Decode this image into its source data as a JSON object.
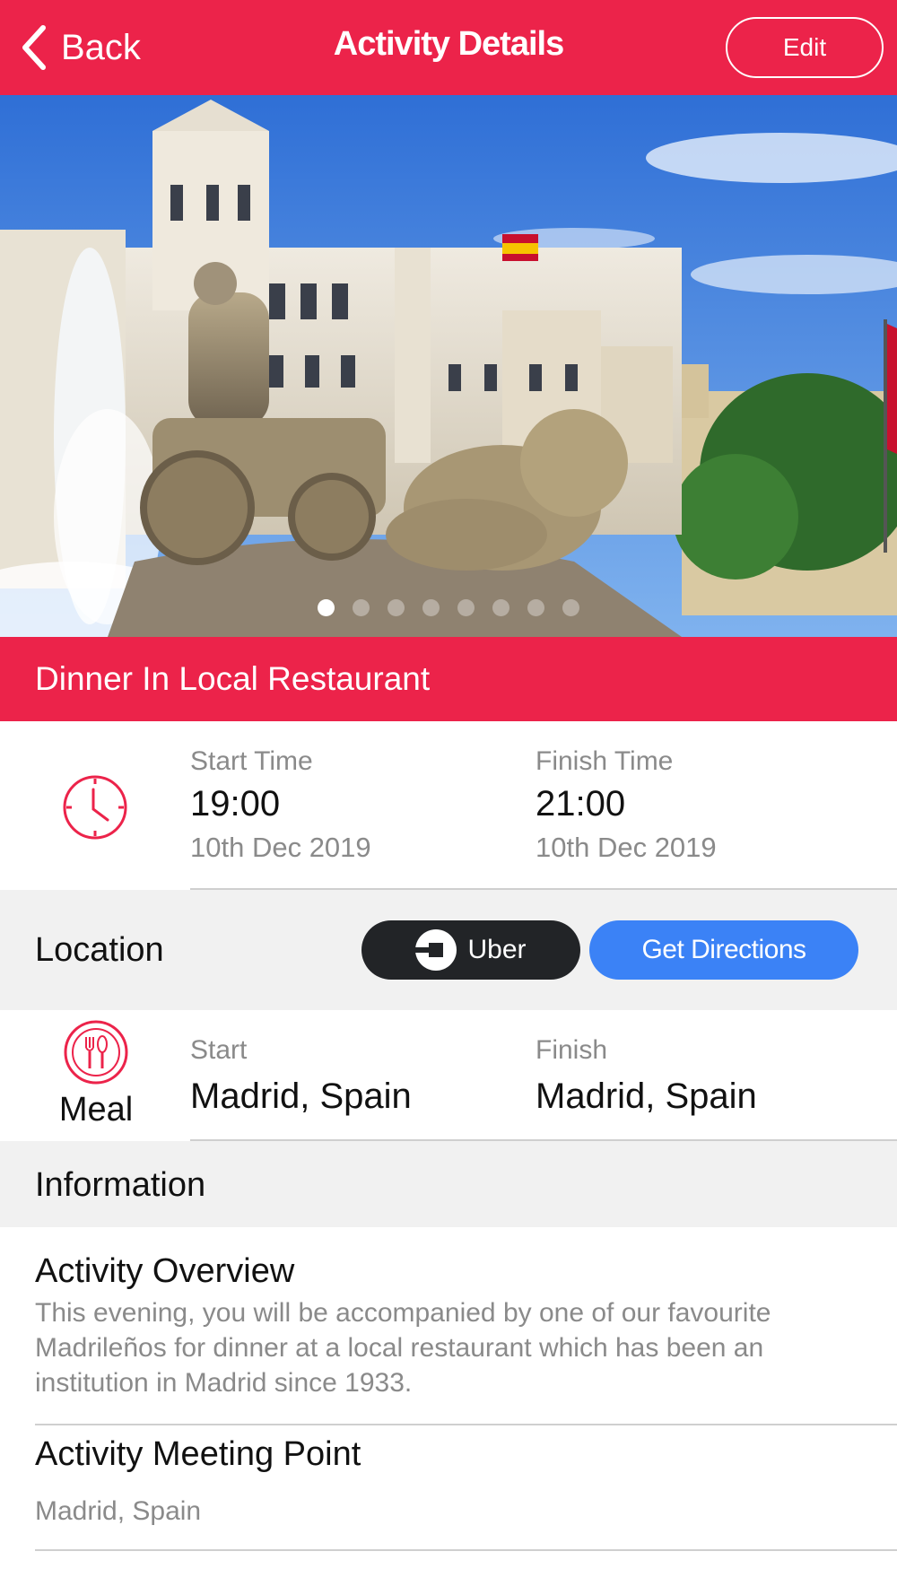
{
  "header": {
    "back_label": "Back",
    "title": "Activity Details",
    "edit_label": "Edit"
  },
  "gallery": {
    "total_images": 8,
    "active_index": 0
  },
  "activity": {
    "title": "Dinner In Local Restaurant"
  },
  "time": {
    "start_label": "Start Time",
    "start_time": "19:00",
    "start_date": "10th Dec 2019",
    "finish_label": "Finish Time",
    "finish_time": "21:00",
    "finish_date": "10th Dec 2019"
  },
  "location": {
    "label": "Location",
    "uber_label": "Uber",
    "directions_label": "Get Directions"
  },
  "meal": {
    "category_label": "Meal",
    "start_label": "Start",
    "start_value": "Madrid, Spain",
    "finish_label": "Finish",
    "finish_value": "Madrid, Spain"
  },
  "information": {
    "label": "Information",
    "overview_title": "Activity Overview",
    "overview_text": "This evening, you will be accompanied by one of our favourite Madrileños for dinner at a local restaurant which has been an institution in Madrid since 1933.",
    "meeting_title": "Activity Meeting Point",
    "meeting_value": "Madrid, Spain"
  },
  "colors": {
    "accent": "#ec234a",
    "uber": "#222427",
    "directions": "#3b82f6",
    "section_bg": "#f1f1f1"
  }
}
